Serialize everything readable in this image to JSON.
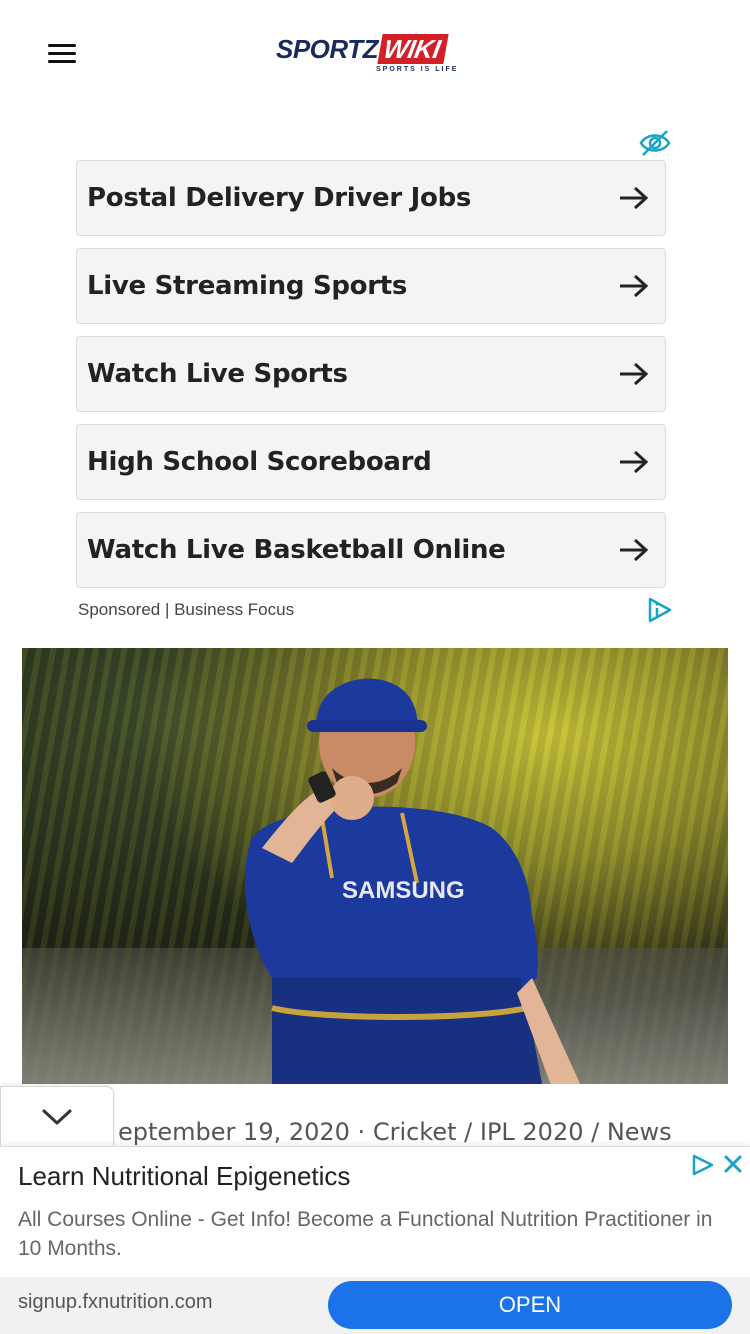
{
  "header": {
    "logo_main": "SPORTZ",
    "logo_accent": "WIKI",
    "logo_tagline": "SPORTS IS LIFE",
    "menu_icon": "hamburger-menu-icon"
  },
  "ad_block": {
    "hide_icon": "eye-slash-icon",
    "items": [
      {
        "label": "Postal Delivery Driver Jobs"
      },
      {
        "label": "Live Streaming Sports"
      },
      {
        "label": "Watch Live Sports"
      },
      {
        "label": "High School Scoreboard"
      },
      {
        "label": "Watch Live Basketball Online"
      }
    ],
    "sponsored_text": "Sponsored | Business Focus",
    "adchoices_icon": "adchoices-icon",
    "accent_color": "#1aa3c4"
  },
  "article": {
    "photo_icon": "article-photo",
    "meta_text": "eptember 19, 2020  ·  Cricket / IPL 2020 / News"
  },
  "bottom_ad": {
    "title": "Learn Nutritional Epigenetics",
    "description": "All Courses Online - Get Info! Become a Functional Nutrition Practitioner in 10 Months.",
    "url": "signup.fxnutrition.com",
    "button_label": "OPEN",
    "button_color": "#1a73e8",
    "icon_color": "#1aa3c4"
  },
  "collapse_icon": "chevron-down-icon"
}
